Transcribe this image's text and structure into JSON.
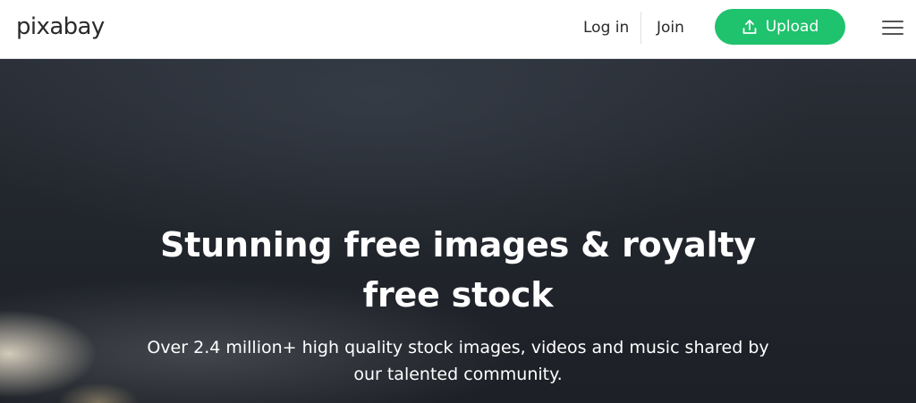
{
  "header": {
    "logo_text": "pixabay",
    "login_label": "Log in",
    "join_label": "Join",
    "upload_label": "Upload",
    "upload_icon": "upload-icon",
    "menu_icon": "hamburger-menu-icon"
  },
  "hero": {
    "title": "Stunning free images & royalty free stock",
    "subtitle": "Over 2.4 million+ high quality stock images, videos and music shared by our talented community."
  },
  "colors": {
    "accent": "#1fc26d",
    "header_bg": "#ffffff",
    "text_dark": "#2a2a2a",
    "hero_bg": "#22262d"
  }
}
